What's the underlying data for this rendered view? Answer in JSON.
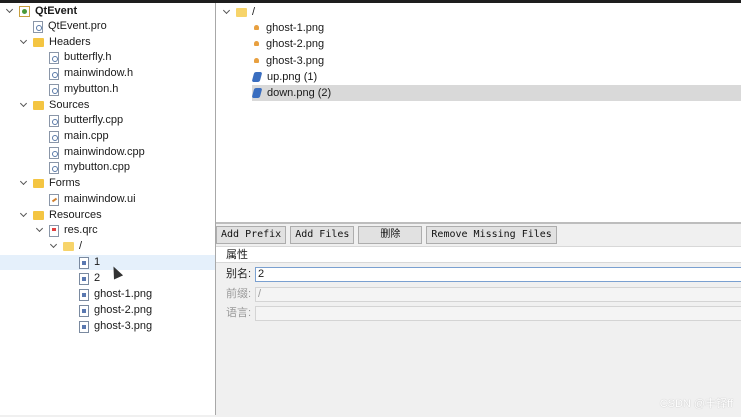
{
  "project_tree": {
    "project": "QtEvent",
    "pro_file": "QtEvent.pro",
    "headers_label": "Headers",
    "headers": [
      "butterfly.h",
      "mainwindow.h",
      "mybutton.h"
    ],
    "sources_label": "Sources",
    "sources": [
      "butterfly.cpp",
      "main.cpp",
      "mainwindow.cpp",
      "mybutton.cpp"
    ],
    "forms_label": "Forms",
    "forms": [
      "mainwindow.ui"
    ],
    "resources_label": "Resources",
    "qrc_file": "res.qrc",
    "prefix": "/",
    "resource_files": [
      "1",
      "2",
      "ghost-1.png",
      "ghost-2.png",
      "ghost-3.png"
    ]
  },
  "file_list": {
    "prefix": "/",
    "files": [
      "ghost-1.png",
      "ghost-2.png",
      "ghost-3.png",
      "up.png (1)",
      "down.png (2)"
    ]
  },
  "toolbar": {
    "add_prefix": "Add Prefix",
    "add_files": "Add Files",
    "delete": "删除",
    "remove_missing": "Remove Missing Files"
  },
  "properties": {
    "header": "属性",
    "alias_label": "别名:",
    "alias_value": "2",
    "prefix_label": "前缀:",
    "prefix_value": "/",
    "language_label": "语言:",
    "language_value": ""
  },
  "watermark": "CSDN @丰铎ff"
}
